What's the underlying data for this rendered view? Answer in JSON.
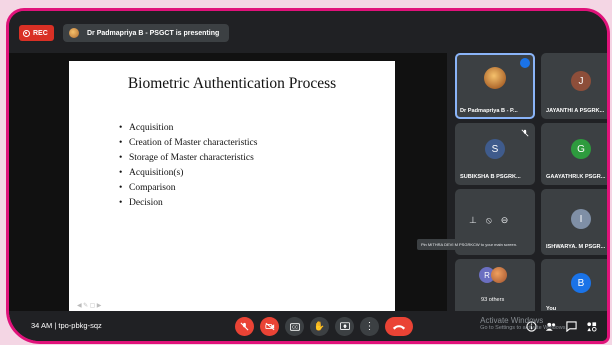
{
  "topbar": {
    "rec_label": "REC",
    "presenting_text": "Dr Padmapriya B - PSGCT is presenting"
  },
  "slide": {
    "title": "Biometric Authentication Process",
    "bullets": [
      "Acquisition",
      "Creation of Master characteristics",
      "Storage of Master characteristics",
      "Acquisition(s)",
      "Comparison",
      "Decision"
    ]
  },
  "participants": [
    {
      "name": "Dr Padmapriya B - P...",
      "initial": "",
      "color": "#b06a2e"
    },
    {
      "name": "JAYANTHI A PSGRK...",
      "initial": "J",
      "color": "#8d4e3a"
    },
    {
      "name": "SUBIKSHA B PSGRK...",
      "initial": "S",
      "color": "#3f5b8c"
    },
    {
      "name": "GAAYATHRI.K PSGR...",
      "initial": "G",
      "color": "#2e9b3e"
    },
    {
      "name": "ISHWARYA. M PSGR...",
      "initial": "I",
      "color": "#7f8fa6"
    },
    {
      "name": "93 others",
      "initial": "R",
      "color": "#6b6fc1"
    },
    {
      "name": "You",
      "initial": "B",
      "color": "#1a73e8"
    }
  ],
  "tooltip": "Pin MITHRA DEVI M PSGRKCW to your main screen.",
  "bottombar": {
    "meeting_info": "34 AM  |  tpo-pbkg-sqz",
    "activate_title": "Activate Windows",
    "activate_sub": "Go to Settings to activate Windows."
  },
  "colors": {
    "frame": "#e0127a",
    "accent": "#8ab4f8",
    "danger": "#ea4335"
  }
}
